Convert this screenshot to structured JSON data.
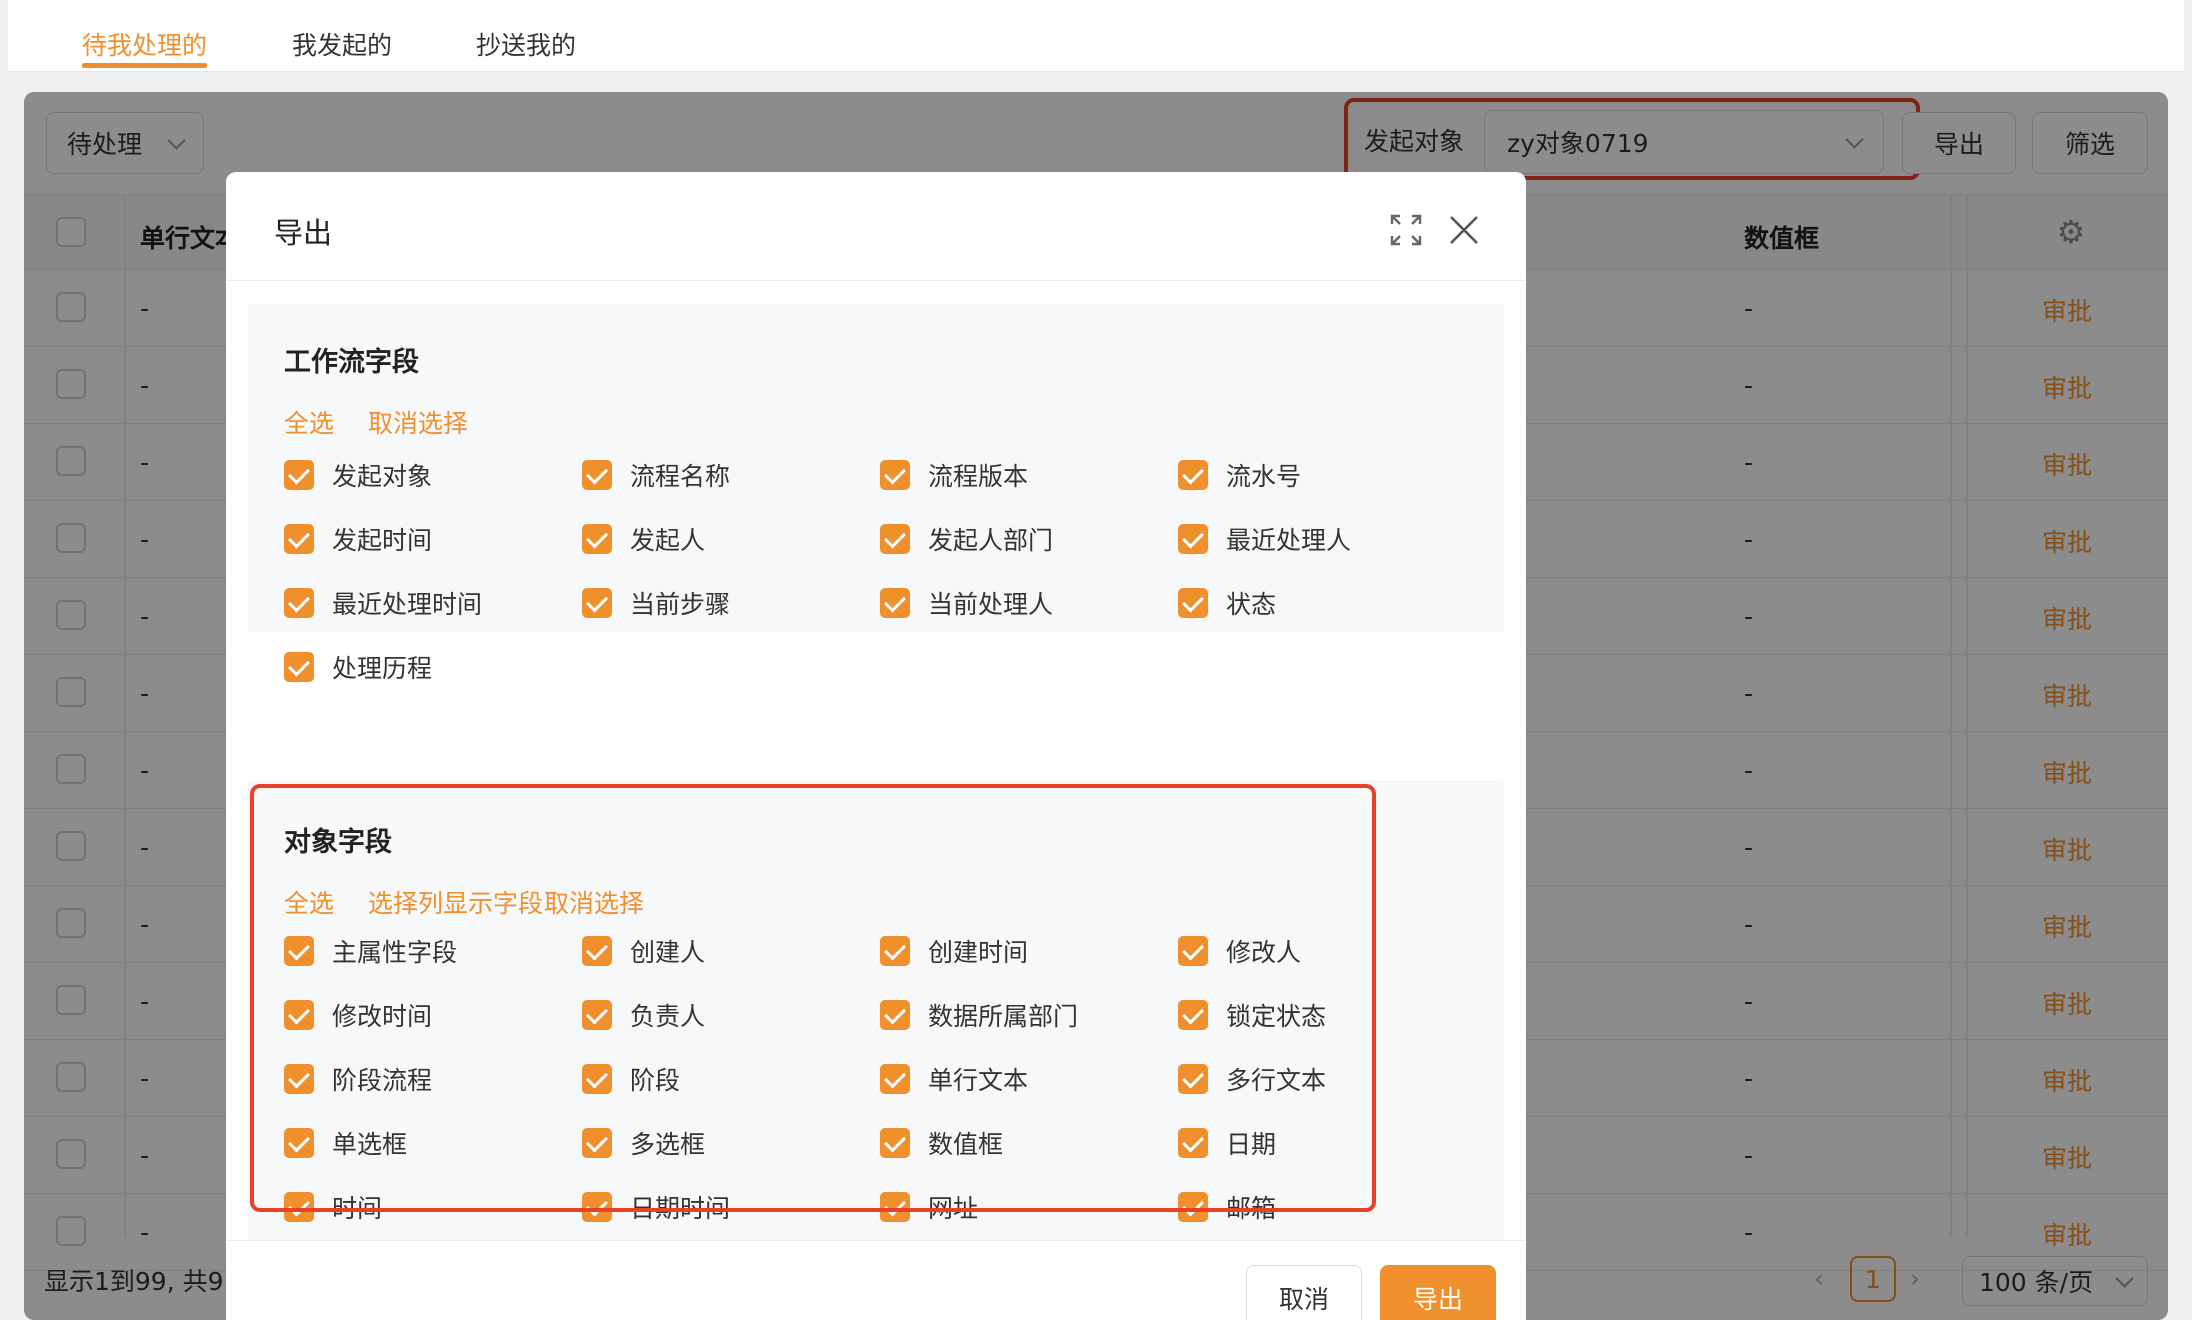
{
  "tabs": [
    {
      "label": "待我处理的",
      "active": true
    },
    {
      "label": "我发起的",
      "active": false
    },
    {
      "label": "抄送我的",
      "active": false
    }
  ],
  "toolbar": {
    "status_select": "待处理",
    "origin_label": "发起对象",
    "origin_value": "zy对象0719",
    "export_label": "导出",
    "filter_label": "筛选"
  },
  "table": {
    "headers": [
      "单行文本",
      "数值框"
    ],
    "row_placeholder": "-",
    "action_label": "审批",
    "row_count_visible": 13
  },
  "footer": {
    "summary": "显示1到99, 共9",
    "current_page": "1",
    "page_size": "100 条/页"
  },
  "modal": {
    "title": "导出",
    "workflow_section": {
      "title": "工作流字段",
      "select_all": "全选",
      "deselect": "取消选择",
      "fields": [
        "发起对象",
        "流程名称",
        "流程版本",
        "流水号",
        "发起时间",
        "发起人",
        "发起人部门",
        "最近处理人",
        "最近处理时间",
        "当前步骤",
        "当前处理人",
        "状态",
        "处理历程"
      ]
    },
    "object_section": {
      "title": "对象字段",
      "select_all": "全选",
      "select_display": "选择列显示字段",
      "deselect": "取消选择",
      "fields": [
        "主属性字段",
        "创建人",
        "创建时间",
        "修改人",
        "修改时间",
        "负责人",
        "数据所属部门",
        "锁定状态",
        "阶段流程",
        "阶段",
        "单行文本",
        "多行文本",
        "单选框",
        "多选框",
        "数值框",
        "日期",
        "时间",
        "日期时间",
        "网址",
        "邮箱"
      ]
    },
    "cancel_label": "取消",
    "export_label": "导出"
  },
  "colors": {
    "accent": "#f0902c",
    "highlight_box": "#e8402a"
  }
}
